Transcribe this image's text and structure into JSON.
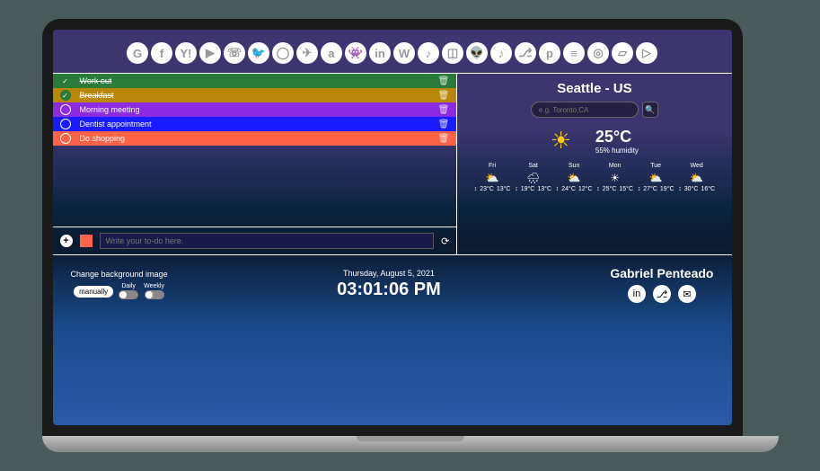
{
  "social": [
    "G",
    "f",
    "Y!",
    "▶",
    "☏",
    "🐦",
    "◯",
    "✈",
    "a",
    "👾",
    "in",
    "W",
    "♪",
    "◫",
    "👽",
    "♪",
    "⎇",
    "p",
    "≡",
    "◎",
    "▱",
    "▷"
  ],
  "todos": [
    {
      "text": "Work out",
      "done": true,
      "color": "c1"
    },
    {
      "text": "Breakfast",
      "done": true,
      "color": "c2"
    },
    {
      "text": "Morning meeting",
      "done": false,
      "color": "c3"
    },
    {
      "text": "Dentist appointment",
      "done": false,
      "color": "c4"
    },
    {
      "text": "Do shopping",
      "done": false,
      "color": "c5"
    }
  ],
  "todo_input": {
    "placeholder": "Write your to-do here."
  },
  "weather": {
    "city": "Seattle - US",
    "search_placeholder": "e.g. Toronto,CA",
    "temp": "25°C",
    "humidity": "55% humidity",
    "forecast": [
      {
        "day": "Fri",
        "hi": "23°C",
        "lo": "13°C",
        "icon": "⛅"
      },
      {
        "day": "Sat",
        "hi": "19°C",
        "lo": "13°C",
        "icon": "🌧"
      },
      {
        "day": "Sun",
        "hi": "24°C",
        "lo": "12°C",
        "icon": "⛅"
      },
      {
        "day": "Mon",
        "hi": "25°C",
        "lo": "15°C",
        "icon": "☀"
      },
      {
        "day": "Tue",
        "hi": "27°C",
        "lo": "19°C",
        "icon": "⛅"
      },
      {
        "day": "Wed",
        "hi": "30°C",
        "lo": "16°C",
        "icon": "⛅"
      }
    ]
  },
  "bg": {
    "title": "Change background image",
    "manual": "manually",
    "daily": "Daily",
    "weekly": "Weekly"
  },
  "clock": {
    "date": "Thursday, August 5, 2021",
    "time": "03:01:06 PM"
  },
  "author": {
    "name": "Gabriel Penteado"
  }
}
